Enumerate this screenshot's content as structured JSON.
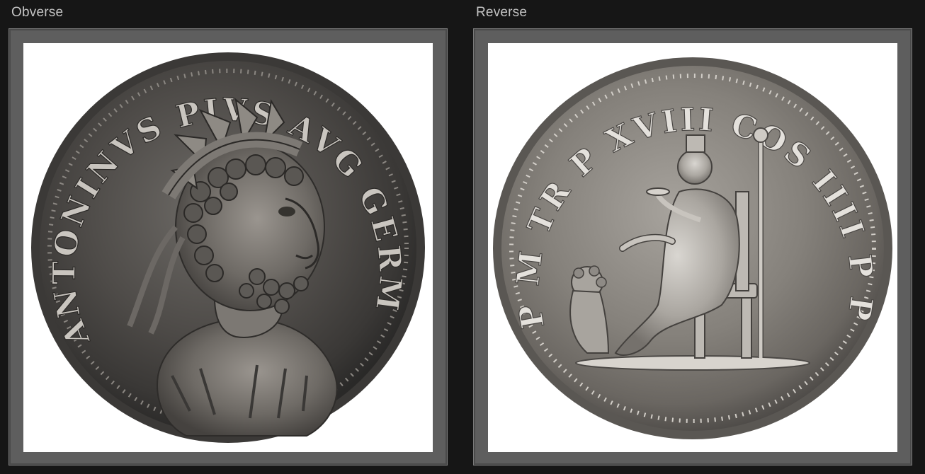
{
  "viewer": {
    "panels": [
      {
        "id": "obverse",
        "label": "Obverse",
        "legend": "ANTONINVS PIVS AVG GERM"
      },
      {
        "id": "reverse",
        "label": "Reverse",
        "legend": "P M TR P XVIII COS IIII P P"
      }
    ]
  },
  "colors": {
    "background": "#161616",
    "frame": "#5e5e5e",
    "photo_background": "#ffffff",
    "label_text": "#c4c4c4",
    "coin_silver": "#8a8680"
  }
}
